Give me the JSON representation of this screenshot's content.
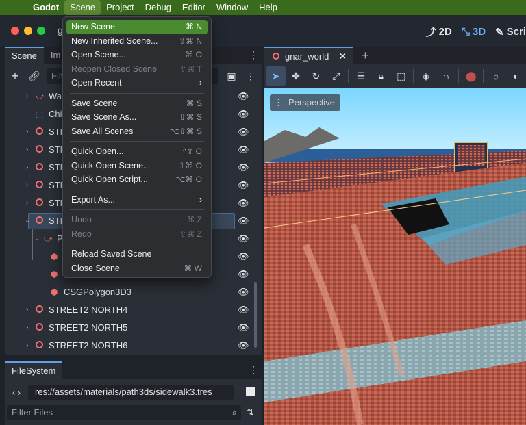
{
  "menubar": {
    "app": "Godot",
    "items": [
      "Scene",
      "Project",
      "Debug",
      "Editor",
      "Window",
      "Help"
    ]
  },
  "title": {
    "project_fragment": "g",
    "modes": [
      "2D",
      "3D",
      "Scri"
    ]
  },
  "scene_dock": {
    "tabs": [
      "Scene",
      "Im"
    ],
    "filter_fragment": "Filt",
    "tree": [
      {
        "label": "Wa",
        "icon": "path-icon"
      },
      {
        "label": "Chi",
        "icon": "collision-shape-icon"
      },
      {
        "label": "STF",
        "icon": "node3d-icon"
      },
      {
        "label": "STF",
        "icon": "node3d-icon"
      },
      {
        "label": "STF",
        "icon": "node3d-icon"
      },
      {
        "label": "STF",
        "icon": "node3d-icon"
      },
      {
        "label": "STF",
        "icon": "node3d-icon"
      },
      {
        "label": "STF",
        "icon": "node3d-icon"
      },
      {
        "label": "P",
        "icon": "path-icon"
      },
      {
        "label": "",
        "icon": "csg-icon"
      },
      {
        "label": "",
        "icon": "csg-icon"
      },
      {
        "label": "CSGPolygon3D3",
        "icon": "csg-icon"
      },
      {
        "label": "STREET2 NORTH4",
        "icon": "node3d-icon"
      },
      {
        "label": "STREET2 NORTH5",
        "icon": "node3d-icon"
      },
      {
        "label": "STREET2 NORTH6",
        "icon": "node3d-icon"
      }
    ]
  },
  "filesystem": {
    "tab": "FileSystem",
    "path": "res://assets/materials/path3ds/sidewalk3.tres",
    "filter_placeholder": "Filter Files"
  },
  "viewport": {
    "tab": "gnar_world",
    "perspective": "Perspective"
  },
  "scene_menu": {
    "items": [
      {
        "label": "New Scene",
        "shortcut": "⌘ N",
        "state": "highlight"
      },
      {
        "label": "New Inherited Scene...",
        "shortcut": "⇧⌘ N",
        "state": "normal"
      },
      {
        "label": "Open Scene...",
        "shortcut": "⌘ O",
        "state": "normal"
      },
      {
        "label": "Reopen Closed Scene",
        "shortcut": "⇧⌘ T",
        "state": "disabled"
      },
      {
        "label": "Open Recent",
        "shortcut": "",
        "state": "submenu"
      },
      {
        "label": "Save Scene",
        "shortcut": "⌘ S",
        "state": "normal"
      },
      {
        "label": "Save Scene As...",
        "shortcut": "⇧⌘ S",
        "state": "normal"
      },
      {
        "label": "Save All Scenes",
        "shortcut": "⌥⇧⌘ S",
        "state": "normal"
      },
      {
        "label": "Quick Open...",
        "shortcut": "^⇧ O",
        "state": "normal"
      },
      {
        "label": "Quick Open Scene...",
        "shortcut": "⇧⌘ O",
        "state": "normal"
      },
      {
        "label": "Quick Open Script...",
        "shortcut": "⌥⌘ O",
        "state": "normal"
      },
      {
        "label": "Export As...",
        "shortcut": "",
        "state": "submenu"
      },
      {
        "label": "Undo",
        "shortcut": "⌘ Z",
        "state": "disabled"
      },
      {
        "label": "Redo",
        "shortcut": "⇧⌘ Z",
        "state": "disabled"
      },
      {
        "label": "Reload Saved Scene",
        "shortcut": "",
        "state": "normal"
      },
      {
        "label": "Close Scene",
        "shortcut": "⌘ W",
        "state": "normal"
      }
    ]
  },
  "colors": {
    "menubar": "#3a6b1c",
    "menu_highlight": "#4b8b2f",
    "accent": "#5f9ee8",
    "node_icon": "#f0706c"
  }
}
